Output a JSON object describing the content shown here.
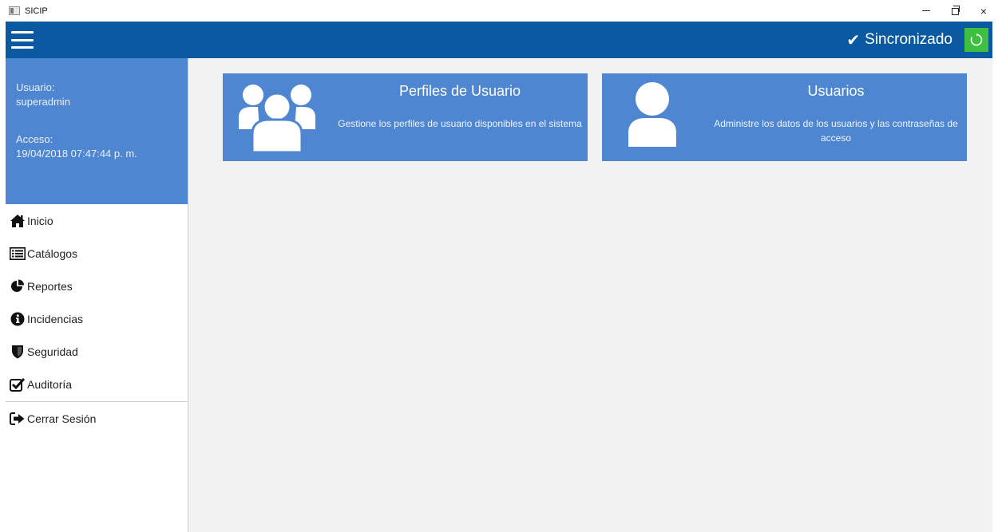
{
  "window": {
    "title": "SICIP",
    "controls": {
      "minimize": "minimize-icon",
      "maximize": "restore-icon",
      "close": "×"
    }
  },
  "header": {
    "menu_icon": "hamburger-icon",
    "sync_check": "✔",
    "sync_label": "Sincronizado",
    "sync_button_icon": "refresh-icon",
    "colors": {
      "bar": "#0b5aa1",
      "sync_button": "#3fbf3f"
    }
  },
  "user_panel": {
    "user_label": "Usuario:",
    "user_value": "superadmin",
    "access_label": "Acceso:",
    "access_value": "19/04/2018 07:47:44 p. m.",
    "color": "#4f86d1"
  },
  "nav": {
    "items": [
      {
        "label": "Inicio",
        "icon": "home-icon"
      },
      {
        "label": "Catálogos",
        "icon": "list-icon"
      },
      {
        "label": "Reportes",
        "icon": "pie-chart-icon"
      },
      {
        "label": "Incidencias",
        "icon": "info-icon"
      },
      {
        "label": "Seguridad",
        "icon": "shield-icon"
      },
      {
        "label": "Auditoría",
        "icon": "checkbox-icon"
      }
    ],
    "logout": {
      "label": "Cerrar Sesión",
      "icon": "sign-out-icon"
    }
  },
  "tiles": [
    {
      "title": "Perfiles de Usuario",
      "description": "Gestione los perfiles de usuario disponibles en el sistema",
      "icon": "users-group-icon"
    },
    {
      "title": "Usuarios",
      "description": "Administre los datos de los usuarios y las contraseñas de acceso",
      "icon": "user-icon"
    }
  ]
}
